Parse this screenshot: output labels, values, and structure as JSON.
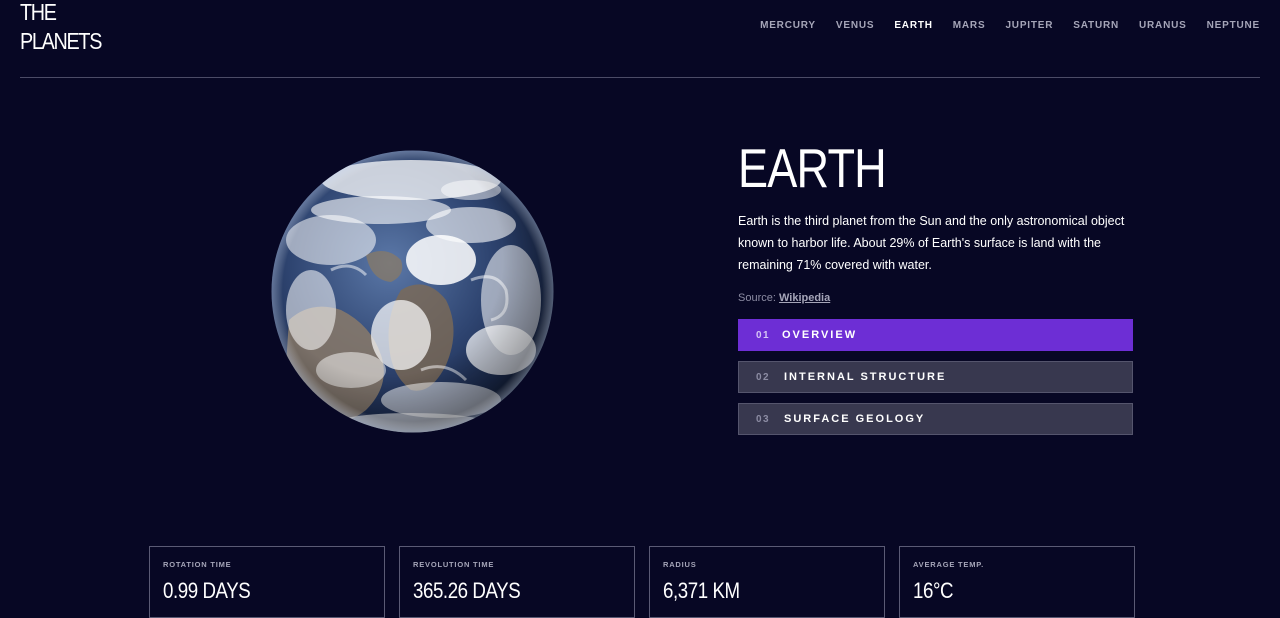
{
  "header": {
    "logo_line1": "THE",
    "logo_line2": "PLANETS",
    "nav": [
      {
        "label": "MERCURY",
        "active": false
      },
      {
        "label": "VENUS",
        "active": false
      },
      {
        "label": "EARTH",
        "active": true
      },
      {
        "label": "MARS",
        "active": false
      },
      {
        "label": "JUPITER",
        "active": false
      },
      {
        "label": "SATURN",
        "active": false
      },
      {
        "label": "URANUS",
        "active": false
      },
      {
        "label": "NEPTUNE",
        "active": false
      }
    ]
  },
  "planet": {
    "name": "EARTH",
    "description": "Earth is the third planet from the Sun and the only astronomical object known to harbor life. About 29% of Earth's surface is land with the remaining 71% covered with water.",
    "source_prefix": "Source:",
    "source_link": "Wikipedia",
    "image_icon": "earth-globe"
  },
  "tabs": [
    {
      "number": "01",
      "label": "OVERVIEW",
      "active": true
    },
    {
      "number": "02",
      "label": "INTERNAL STRUCTURE",
      "active": false
    },
    {
      "number": "03",
      "label": "SURFACE GEOLOGY",
      "active": false
    }
  ],
  "stats": [
    {
      "label": "ROTATION TIME",
      "value": "0.99 DAYS"
    },
    {
      "label": "REVOLUTION TIME",
      "value": "365.26 DAYS"
    },
    {
      "label": "RADIUS",
      "value": "6,371 KM"
    },
    {
      "label": "AVERAGE TEMP.",
      "value": "16°C"
    }
  ],
  "colors": {
    "background": "#070724",
    "active_tab": "#6d2ed5",
    "inactive_tab": "#38384f",
    "divider": "#4b4b66"
  }
}
